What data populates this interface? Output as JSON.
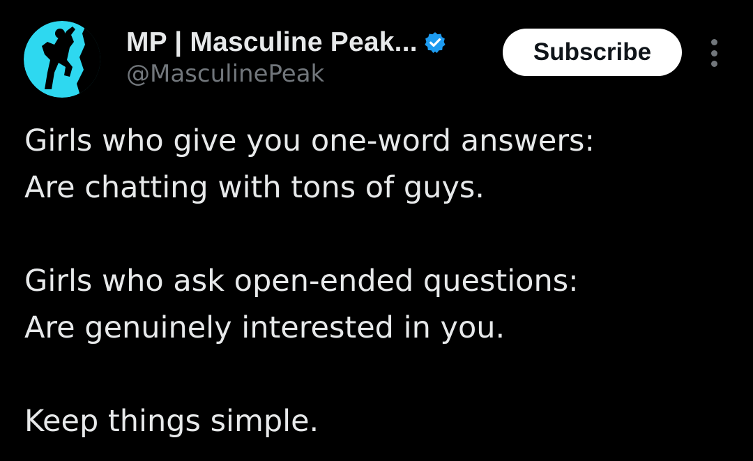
{
  "account": {
    "display_name": "MP | Masculine Peak...",
    "handle": "@MasculinePeak",
    "avatar_icon": "climber-silhouette-avatar",
    "verified_icon": "verified-badge-icon",
    "verified_color": "#1d9bf0",
    "avatar_color": "#2ed8f0"
  },
  "header": {
    "subscribe_label": "Subscribe",
    "more_icon": "more-vertical-icon"
  },
  "tweet": {
    "lines": [
      "Girls who give you one-word answers:",
      "Are chatting with tons of guys.",
      "",
      "Girls who ask open-ended questions:",
      "Are genuinely interested in you.",
      "",
      "Keep things simple."
    ]
  },
  "colors": {
    "background": "#000000",
    "text_primary": "#e7e9ea",
    "text_secondary": "#71767b",
    "button_bg": "#ffffff",
    "button_text": "#0f1419"
  }
}
